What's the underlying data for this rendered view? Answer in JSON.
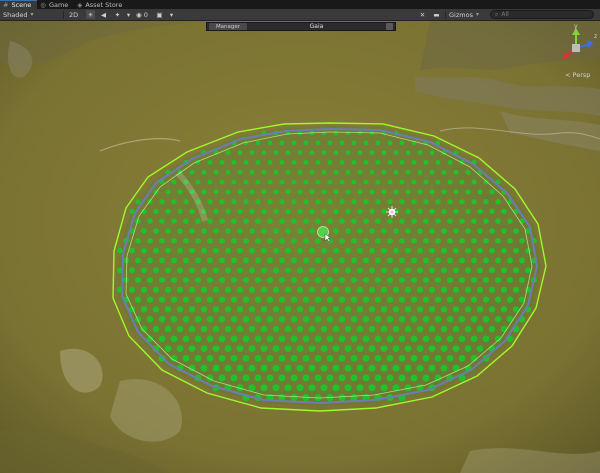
{
  "tabs": [
    {
      "label": "Scene",
      "icon": "hashtag-icon",
      "active": true
    },
    {
      "label": "Game",
      "icon": "gamepad-icon",
      "active": false
    },
    {
      "label": "Asset Store",
      "icon": "bag-icon",
      "active": false
    }
  ],
  "toolbar": {
    "shading_mode": "Shaded",
    "mode_2d": "2D",
    "hidden_count": "0",
    "gizmos_label": "Gizmos",
    "search_placeholder": "All"
  },
  "overlay": {
    "manager_label": "Manager",
    "title": "Gaia"
  },
  "gizmo": {
    "axis_labels": {
      "y": "y",
      "z": "z"
    },
    "projection_label": "< Persp"
  },
  "scene": {
    "colors": {
      "terrain": "#837a35",
      "terrain_dark": "#5f5a26",
      "stamp_ring": "#9dfa2b",
      "stamp_dots": "#20c22c",
      "spline": "#6f7bb4"
    }
  }
}
